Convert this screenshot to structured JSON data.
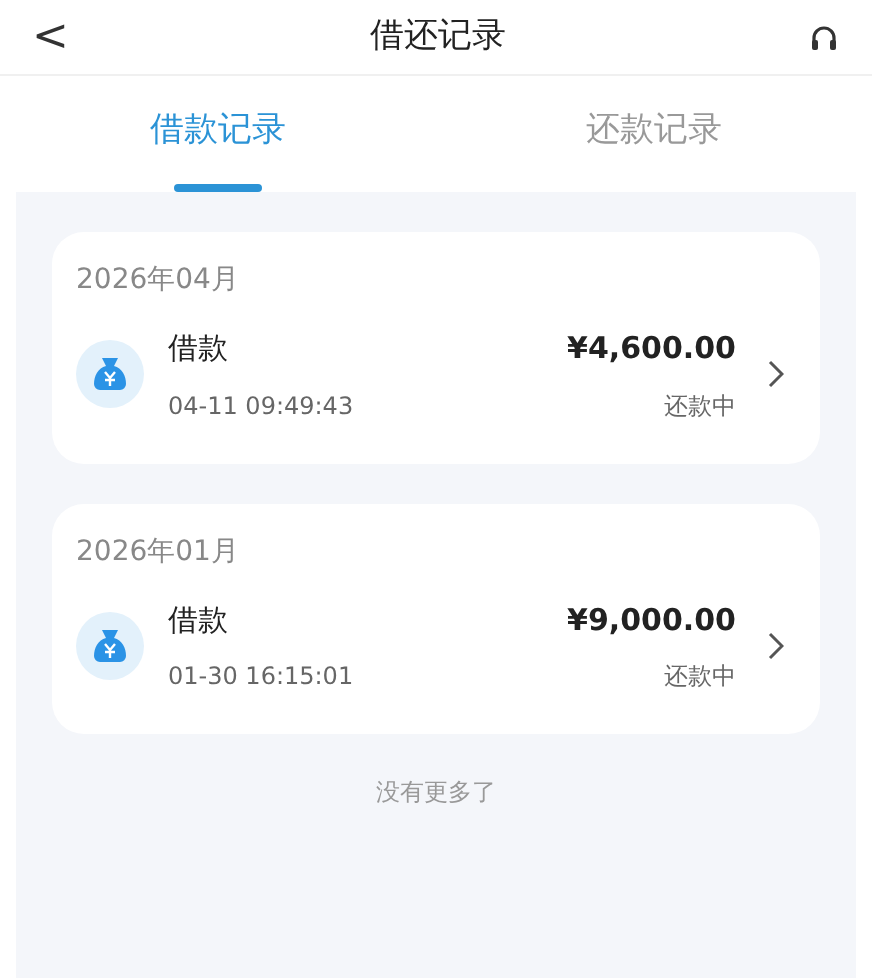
{
  "header": {
    "back": "<",
    "title": "借还记录"
  },
  "tabs": [
    {
      "label": "借款记录",
      "selected": true
    },
    {
      "label": "还款记录",
      "selected": false
    }
  ],
  "groups": [
    {
      "month": "2026年04月",
      "records": [
        {
          "title": "借款",
          "time": "04-11 09:49:43",
          "amount": "¥4,600.00",
          "status": "还款中"
        }
      ]
    },
    {
      "month": "2026年01月",
      "records": [
        {
          "title": "借款",
          "time": "01-30 16:15:01",
          "amount": "¥9,000.00",
          "status": "还款中"
        }
      ]
    }
  ],
  "footer": "没有更多了"
}
